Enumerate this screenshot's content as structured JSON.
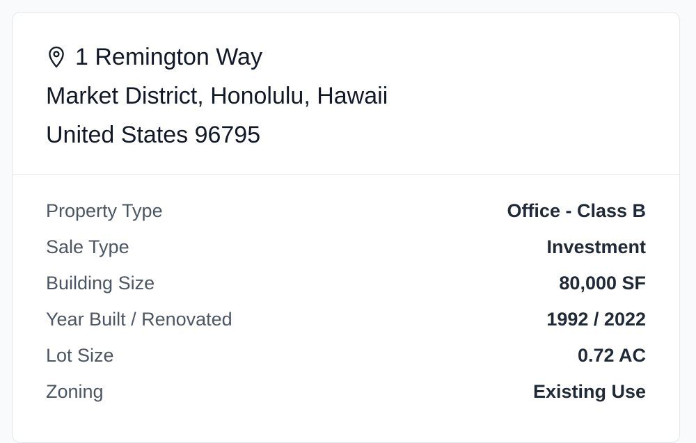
{
  "address": {
    "line1": "1 Remington Way",
    "line2": "Market District, Honolulu, Hawaii",
    "line3": "United States 96795"
  },
  "details": [
    {
      "label": "Property Type",
      "value": "Office - Class B"
    },
    {
      "label": "Sale Type",
      "value": "Investment"
    },
    {
      "label": "Building Size",
      "value": "80,000 SF"
    },
    {
      "label": "Year Built / Renovated",
      "value": "1992 / 2022"
    },
    {
      "label": "Lot Size",
      "value": "0.72 AC"
    },
    {
      "label": "Zoning",
      "value": "Existing Use"
    }
  ],
  "icons": {
    "address_icon": "map-pin-icon"
  },
  "colors": {
    "text_primary": "#111827",
    "text_label": "#4b5563",
    "text_value": "#1f2937",
    "border": "#e5e7eb"
  }
}
